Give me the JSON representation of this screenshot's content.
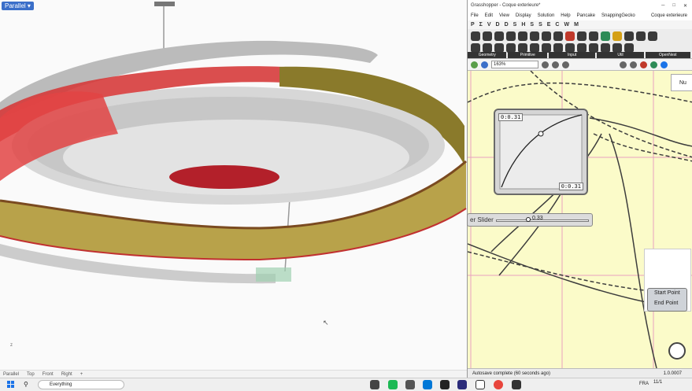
{
  "viewport": {
    "label": "Parallel ▾",
    "tabs": [
      "Parallel",
      "Top",
      "Front",
      "Right",
      "+"
    ],
    "axis": "z"
  },
  "gh": {
    "title": "Grasshopper - Coque exterieure*",
    "menu": [
      "File",
      "Edit",
      "View",
      "Display",
      "Solution",
      "Help",
      "Pancake",
      "SnappingGecko"
    ],
    "doc_name": "Coque exterieure",
    "tabs": [
      "P",
      "Σ",
      "V",
      "D",
      "D",
      "S",
      "H",
      "S",
      "S",
      "E",
      "C",
      "W",
      "M"
    ],
    "ribbon_groups": [
      "Geometry",
      "Primitive",
      "Input",
      "Util",
      "OpenNest"
    ],
    "zoom": "163%",
    "status": "Autosave complete (60 seconds ago)",
    "version": "1.0.0007",
    "graph": {
      "top": "0:0.31",
      "bottom": "0:0.31"
    },
    "slider": {
      "label": "er Slider",
      "value": "0.33"
    },
    "points": {
      "start": "Start Point",
      "end": "End Point"
    },
    "num": "Nu"
  },
  "taskbar": {
    "search": "Everything",
    "lang": "FRA",
    "time": "11/1"
  },
  "colors": {
    "canvas": "#fbfbc9",
    "accent": "#3b6fc9",
    "wire": "#3c3c3c"
  }
}
